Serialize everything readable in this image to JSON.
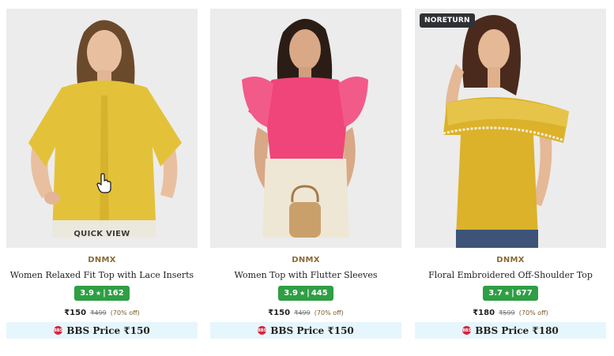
{
  "products": [
    {
      "brand": "DNMX",
      "title": "Women Relaxed Fit Top with Lace Inserts",
      "rating": "3.9",
      "rating_star": "★",
      "rating_sep": "|",
      "rating_count": "162",
      "price": "₹150",
      "mrp": "₹499",
      "discount": "(70% off)",
      "bbs_label": "BBS Price ₹150",
      "quick_view": "QUICK VIEW",
      "tag": "",
      "image_icon": "model-photo",
      "top_color": "#e3c23a"
    },
    {
      "brand": "DNMX",
      "title": "Women Top with Flutter Sleeves",
      "rating": "3.9",
      "rating_star": "★",
      "rating_sep": "|",
      "rating_count": "445",
      "price": "₹150",
      "mrp": "₹499",
      "discount": "(70% off)",
      "bbs_label": "BBS Price ₹150",
      "quick_view": "",
      "tag": "",
      "image_icon": "model-photo",
      "top_color": "#f0457a"
    },
    {
      "brand": "DNMX",
      "title": "Floral Embroidered Off-Shoulder Top",
      "rating": "3.7",
      "rating_star": "★",
      "rating_sep": "|",
      "rating_count": "677",
      "price": "₹180",
      "mrp": "₹599",
      "discount": "(70% off)",
      "bbs_label": "BBS Price ₹180",
      "quick_view": "",
      "tag": "NORETURN",
      "image_icon": "model-photo",
      "top_color": "#dcb22a"
    }
  ],
  "bbs_badge_text": "BBS",
  "colors": {
    "rating_bg": "#2f9e44",
    "brand": "#8b6a35",
    "bbs_bg": "#e6f6fd",
    "tag_bg": "#2f3135"
  }
}
